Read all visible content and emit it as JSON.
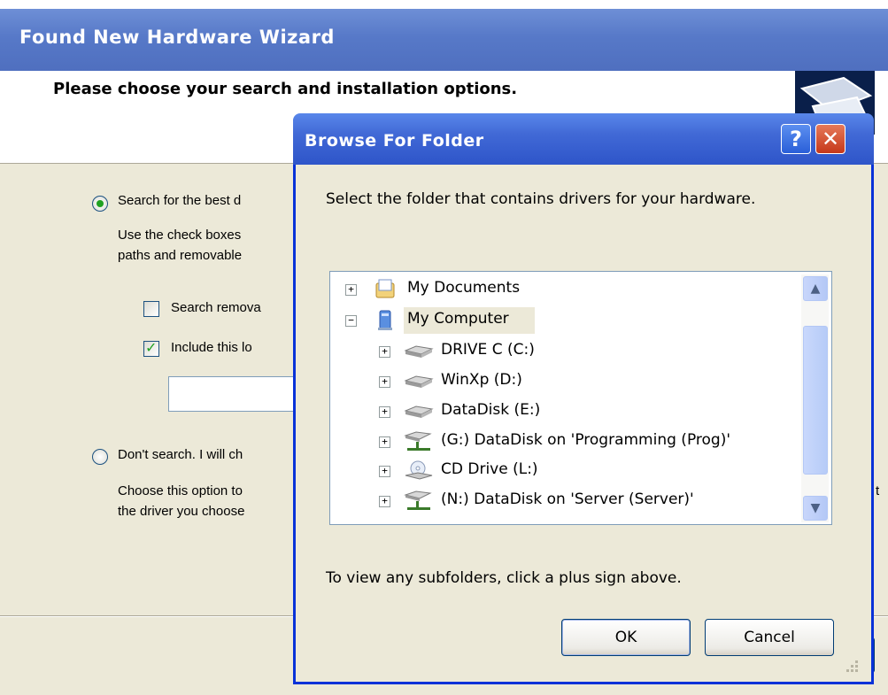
{
  "wizard": {
    "title": "Found New Hardware Wizard",
    "header": "Please choose your search and installation options.",
    "option_search_label": "Search for the best d",
    "option_search_desc_line1": "Use the check boxes",
    "option_search_desc_line2": "paths and removable",
    "checkbox_removable_label": "Search remova",
    "checkbox_include_label": "Include this lo",
    "option_dont_search_label": "Don't search. I will ch",
    "option_dont_desc_line1": "Choose this option to",
    "option_dont_desc_line2": "the driver you choose",
    "right_edge_char": "t",
    "option_search_selected": true,
    "checkbox_removable_checked": false,
    "checkbox_include_checked": true
  },
  "browse": {
    "title": "Browse For Folder",
    "help_label": "?",
    "close_label": "✕",
    "description": "Select the folder that contains drivers for your hardware.",
    "hint": "To view any subfolders, click a plus sign above.",
    "ok_label": "OK",
    "cancel_label": "Cancel",
    "tree": [
      {
        "label": "My Documents",
        "expander": "+",
        "icon": "my-documents-icon"
      },
      {
        "label": "My Computer",
        "expander": "−",
        "icon": "my-computer-icon",
        "selected": true
      },
      {
        "label": "DRIVE C (C:)",
        "expander": "+",
        "icon": "hard-drive-icon"
      },
      {
        "label": "WinXp (D:)",
        "expander": "+",
        "icon": "hard-drive-icon"
      },
      {
        "label": "DataDisk (E:)",
        "expander": "+",
        "icon": "hard-drive-icon"
      },
      {
        "label": "(G:) DataDisk on 'Programming (Prog)'",
        "expander": "+",
        "icon": "network-drive-icon"
      },
      {
        "label": "CD Drive (L:)",
        "expander": "+",
        "icon": "cd-drive-icon"
      },
      {
        "label": "(N:) DataDisk on 'Server (Server)'",
        "expander": "+",
        "icon": "network-drive-icon"
      }
    ]
  }
}
